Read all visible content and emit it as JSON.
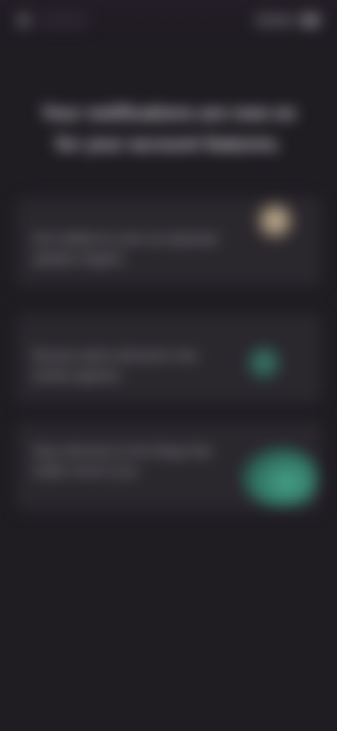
{
  "status_bar": {
    "left_icon": "status-dot-icon",
    "right_icons": [
      "signal-icon",
      "battery-icon"
    ]
  },
  "headline": {
    "text": "Your notifications are now on for your account features."
  },
  "cards": [
    {
      "text": "Get notified as soon as important updates happen.",
      "icon": "sun-icon"
    },
    {
      "text": "Receive alerts whenever new activity appears.",
      "icon": "dot-icon"
    },
    {
      "text": "Stay informed on the things that matter most to you.",
      "icon": "check-icon"
    }
  ],
  "colors": {
    "background": "#1f1c22",
    "card": "#2a272d",
    "accent_warm": "#d8c6a6",
    "accent_green": "#47a38a"
  }
}
